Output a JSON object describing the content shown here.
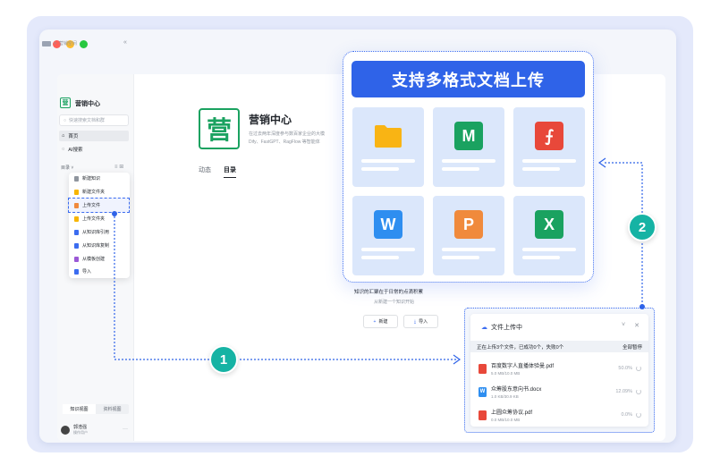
{
  "sidebar": {
    "breadcrumb": "营销空间",
    "collapse_icon": "«",
    "logo_char": "营",
    "title": "营销中心",
    "search_placeholder": "快速搜索文档和群",
    "nav": [
      {
        "label": "首页",
        "icon": "home-icon"
      },
      {
        "label": "AI搜索",
        "icon": "ai-search-icon"
      }
    ],
    "dir_label": "目录",
    "tabs": [
      "知识视图",
      "资料视图"
    ],
    "user": {
      "name": "郭浩强",
      "role": "操作用户"
    }
  },
  "menu": {
    "items": [
      {
        "label": "新建知识",
        "color": "#8f959e"
      },
      {
        "label": "新建文件夹",
        "color": "#f7b500"
      },
      {
        "label": "上传文件",
        "color": "#f08a3c"
      },
      {
        "label": "上传文件夹",
        "color": "#f7b500"
      },
      {
        "label": "从知识库引用",
        "color": "#3b6cf0"
      },
      {
        "label": "从知识库复制",
        "color": "#3b6cf0"
      },
      {
        "label": "从模板创建",
        "color": "#9b59d6"
      },
      {
        "label": "导入",
        "color": "#3b6cf0"
      }
    ]
  },
  "main": {
    "logo_char": "营",
    "title": "营销中心",
    "desc_line1": "在过去两年深度参与数百家企业的大模",
    "desc_line2": "Dify、FastGPT、RagFlow 等智能体",
    "tabs": [
      "动态",
      "目录"
    ],
    "empty_text": "知识的汇聚在于日常的点滴积累",
    "empty_sub": "从新建一个知识开始",
    "new_button": "新建",
    "import_button": "导入"
  },
  "formats_panel": {
    "title": "支持多格式文档上传",
    "formats": [
      {
        "name": "folder",
        "glyph": "",
        "color": "#f9b414"
      },
      {
        "name": "markdown",
        "glyph": "M",
        "color": "#1aa260"
      },
      {
        "name": "pdf",
        "glyph": "⨍",
        "color": "#e8483a"
      },
      {
        "name": "word",
        "glyph": "W",
        "color": "#2e8ef0"
      },
      {
        "name": "ppt",
        "glyph": "P",
        "color": "#f08a3c"
      },
      {
        "name": "excel",
        "glyph": "X",
        "color": "#1aa260"
      }
    ]
  },
  "upload_panel": {
    "title": "文件上传中",
    "status": "正在上传3个文件，已成功0个，失败0个",
    "pause_all": "全部暂停",
    "files": [
      {
        "name": "百度数字人直播体验曼.pdf",
        "size": "5.0 MB/10.0 MB",
        "percent": "50.0%",
        "type": "pdf",
        "color": "#e8483a"
      },
      {
        "name": "众筹股东意向书.docx",
        "size": "1.0 KB/30.9 KB",
        "percent": "12.09%",
        "type": "word",
        "color": "#2e8ef0"
      },
      {
        "name": "上圆众筹协议.pdf",
        "size": "0.0 MB/10.0 MB",
        "percent": "0.0%",
        "type": "pdf",
        "color": "#e8483a"
      }
    ]
  },
  "badges": [
    "1",
    "2"
  ],
  "colors": {
    "accent": "#2f63e8",
    "teal": "#16b3a4",
    "brand_green": "#1aa260"
  }
}
